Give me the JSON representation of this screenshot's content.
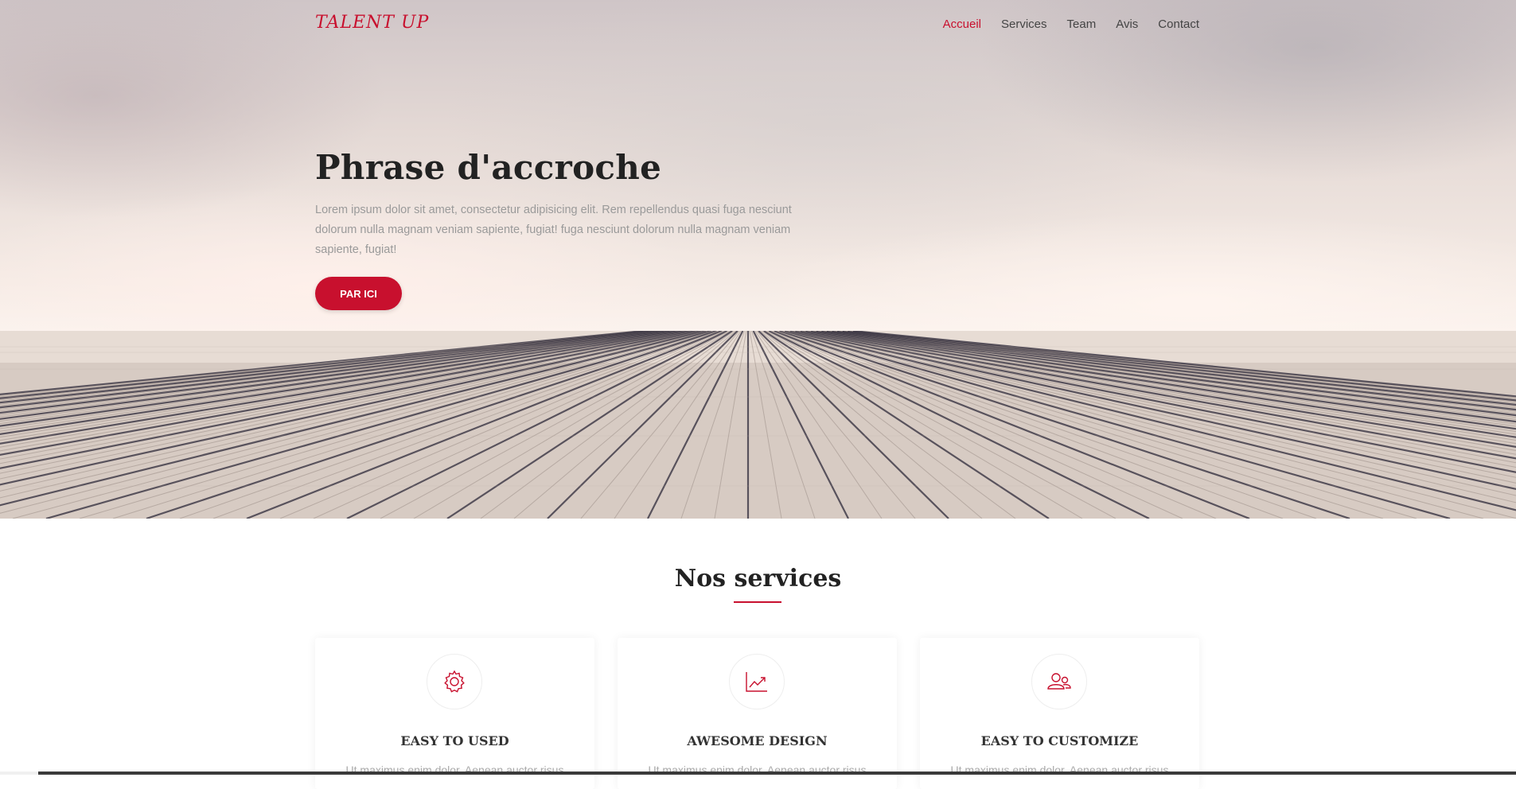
{
  "brand": {
    "name": "TALENT UP"
  },
  "nav": {
    "items": [
      {
        "label": "Accueil",
        "active": true
      },
      {
        "label": "Services",
        "active": false
      },
      {
        "label": "Team",
        "active": false
      },
      {
        "label": "Avis",
        "active": false
      },
      {
        "label": "Contact",
        "active": false
      }
    ]
  },
  "hero": {
    "title": "Phrase d'accroche",
    "text": "Lorem ipsum dolor sit amet, consectetur adipisicing elit. Rem repellendus quasi fuga nesciunt dolorum nulla magnam veniam sapiente, fugiat! fuga nesciunt dolorum nulla magnam veniam sapiente, fugiat!",
    "button_label": "PAR ICI"
  },
  "services": {
    "title": "Nos services",
    "cards": [
      {
        "icon": "gear-icon",
        "title": "EASY TO USED",
        "text": "Ut maximus enim dolor. Aenean auctor risus"
      },
      {
        "icon": "chart-icon",
        "title": "AWESOME DESIGN",
        "text": "Ut maximus enim dolor. Aenean auctor risus"
      },
      {
        "icon": "users-icon",
        "title": "EASY TO CUSTOMIZE",
        "text": "Ut maximus enim dolor. Aenean auctor risus"
      }
    ]
  },
  "colors": {
    "accent": "#c8102e",
    "heading": "#222222",
    "muted_text": "#9a9a9a"
  }
}
